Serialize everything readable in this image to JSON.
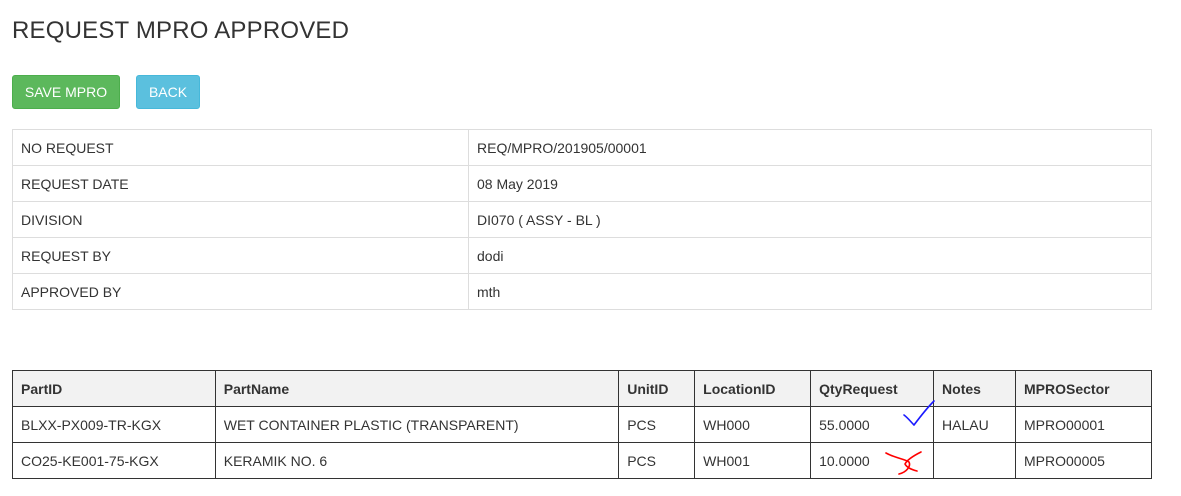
{
  "page": {
    "title": "REQUEST MPRO APPROVED"
  },
  "actions": {
    "save_label": "SAVE MPRO",
    "back_label": "BACK"
  },
  "info": [
    {
      "label": "NO REQUEST",
      "value": "REQ/MPRO/201905/00001"
    },
    {
      "label": "REQUEST DATE",
      "value": "08 May 2019"
    },
    {
      "label": "DIVISION",
      "value": "DI070 ( ASSY - BL )"
    },
    {
      "label": "REQUEST BY",
      "value": "dodi"
    },
    {
      "label": "APPROVED BY",
      "value": "mth"
    }
  ],
  "items_table": {
    "headers": [
      "PartID",
      "PartName",
      "UnitID",
      "LocationID",
      "QtyRequest",
      "Notes",
      "MPROSector"
    ],
    "rows": [
      [
        "BLXX-PX009-TR-KGX",
        "WET CONTAINER PLASTIC (TRANSPARENT)",
        "PCS",
        "WH000",
        "55.0000",
        "HALAU",
        "MPRO00001"
      ],
      [
        "CO25-KE001-75-KGX",
        "KERAMIK NO. 6",
        "PCS",
        "WH001",
        "10.0000",
        "",
        "MPRO00005"
      ]
    ]
  },
  "annotations": {
    "check_icon": "check-mark-icon",
    "check_color": "#1a1aff",
    "cross_icon": "cross-mark-icon",
    "cross_color": "#ff0000"
  }
}
